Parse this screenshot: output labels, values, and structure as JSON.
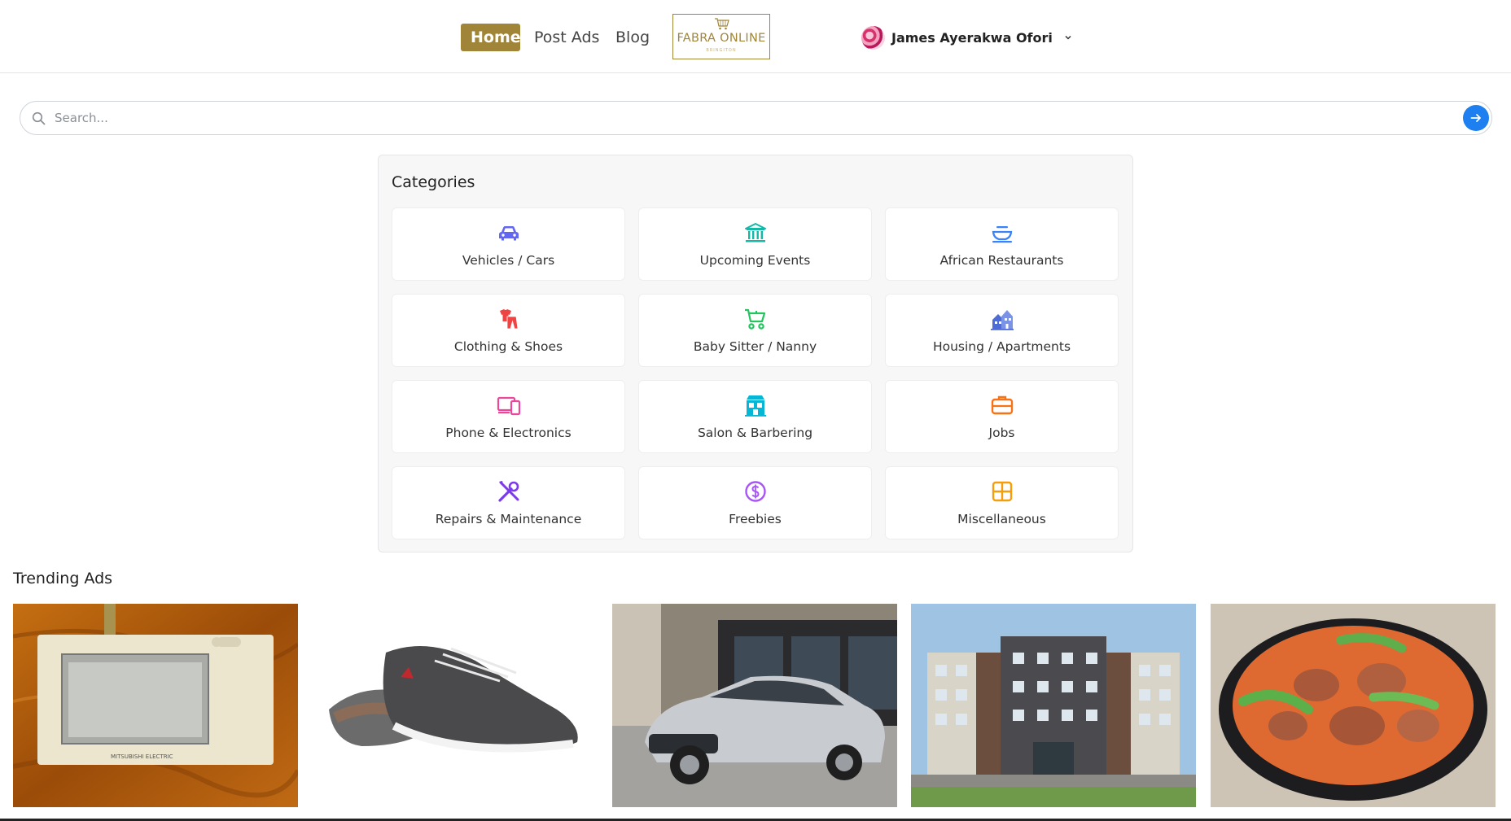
{
  "nav": {
    "home": "Home",
    "post_ads": "Post Ads",
    "blog": "Blog"
  },
  "logo": {
    "brand": "FABRA ONLINE",
    "tagline": "BRINGITON"
  },
  "user": {
    "name": "James Ayerakwa Ofori"
  },
  "search": {
    "placeholder": "Search..."
  },
  "categories": {
    "title": "Categories",
    "items": [
      {
        "label": "Vehicles / Cars",
        "icon": "car-icon",
        "color": "#6366f1"
      },
      {
        "label": "Upcoming Events",
        "icon": "building-icon",
        "color": "#14b8a6"
      },
      {
        "label": "African Restaurants",
        "icon": "food-bowl-icon",
        "color": "#3b82f6"
      },
      {
        "label": "Clothing & Shoes",
        "icon": "clothing-icon",
        "color": "#ef4444"
      },
      {
        "label": "Baby Sitter / Nanny",
        "icon": "stroller-icon",
        "color": "#22c55e"
      },
      {
        "label": "Housing / Apartments",
        "icon": "houses-icon",
        "color": "#4f6bd6"
      },
      {
        "label": "Phone & Electronics",
        "icon": "devices-icon",
        "color": "#ec4899"
      },
      {
        "label": "Salon & Barbering",
        "icon": "salon-icon",
        "color": "#06b6d4"
      },
      {
        "label": "Jobs",
        "icon": "briefcase-icon",
        "color": "#f97316"
      },
      {
        "label": "Repairs & Maintenance",
        "icon": "tools-icon",
        "color": "#7c3aed"
      },
      {
        "label": "Freebies",
        "icon": "dollar-coin-icon",
        "color": "#a855f7"
      },
      {
        "label": "Miscellaneous",
        "icon": "grid-icon",
        "color": "#f59e0b"
      }
    ]
  },
  "trending": {
    "title": "Trending Ads",
    "ads": [
      {
        "image": "thermostat-panel-image"
      },
      {
        "image": "sneaker-image"
      },
      {
        "image": "silver-sedan-image"
      },
      {
        "image": "apartment-building-image"
      },
      {
        "image": "stew-bowl-image"
      }
    ]
  },
  "colors": {
    "accent": "#a08538",
    "primary": "#1e7ff0"
  }
}
